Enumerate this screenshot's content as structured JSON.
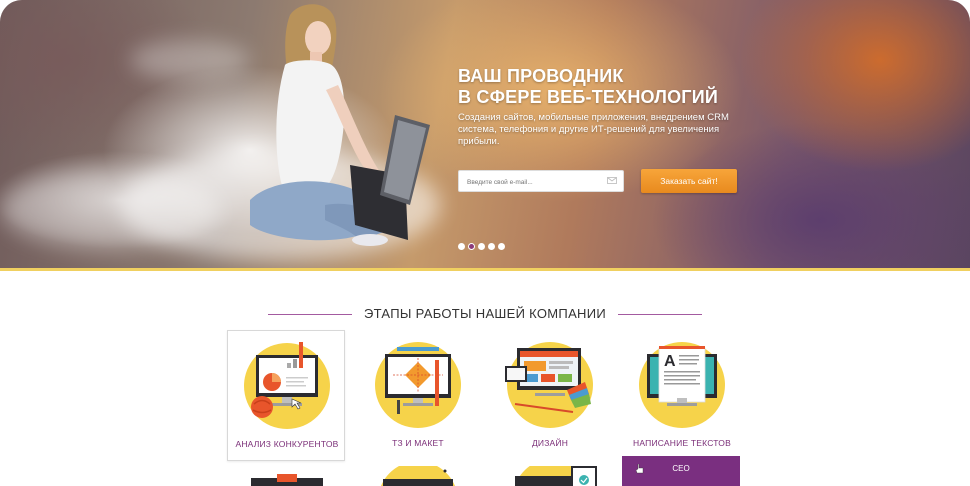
{
  "hero": {
    "title_line1": "ВАШ ПРОВОДНИК",
    "title_line2": "В СФЕРЕ ВЕБ-ТЕХНОЛОГИЙ",
    "subtitle": "Создания сайтов, мобильные приложения,  внедрением CRM система, телефония и другие ИТ-решений для увеличения прибыли.",
    "email_placeholder": "Введите свой e-mail...",
    "order_button": "Заказать сайт!",
    "slides": 5,
    "active_slide": 2
  },
  "section": {
    "title": "ЭТАПЫ РАБОТЫ НАШЕЙ КОМПАНИИ"
  },
  "cards": [
    {
      "label": "АНАЛИЗ КОНКУРЕНТОВ",
      "icon": "competitor-analysis-icon"
    },
    {
      "label": "ТЗ И МАКЕТ",
      "icon": "layout-mockup-icon"
    },
    {
      "label": "ДИЗАЙН",
      "icon": "design-icon"
    },
    {
      "label": "НАПИСАНИЕ ТЕКСТОВ",
      "icon": "copywriting-icon"
    }
  ],
  "dropdown": {
    "item": "СЕО"
  },
  "colors": {
    "accent_purple": "#7a2f80",
    "accent_yellow": "#f6d34a",
    "button_orange": "#f09a2b"
  }
}
